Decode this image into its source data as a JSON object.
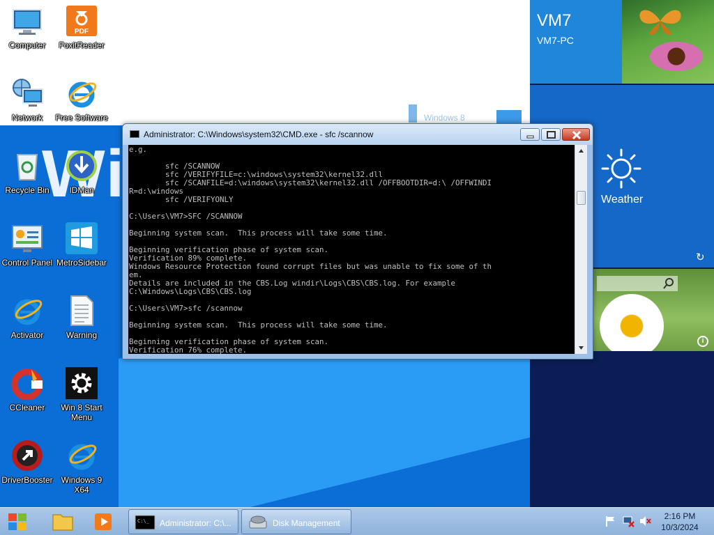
{
  "desktop": {
    "wallpaper_text": "Win",
    "wallpaper_logo_text": "Windows 8",
    "icons": [
      {
        "label": "Computer",
        "icon": "computer-icon"
      },
      {
        "label": "FoxitReader",
        "icon": "pdf-icon",
        "badge": "PDF"
      },
      {
        "label": "Network",
        "icon": "network-icon"
      },
      {
        "label": "Free Software",
        "icon": "internet-explorer-icon"
      },
      {
        "label": "Recycle Bin",
        "icon": "recycle-bin-icon"
      },
      {
        "label": "IDMan",
        "icon": "download-manager-icon"
      },
      {
        "label": "Control Panel",
        "icon": "control-panel-icon"
      },
      {
        "label": "MetroSidebar",
        "icon": "metro-sidebar-icon"
      },
      {
        "label": "Activator",
        "icon": "internet-explorer-icon"
      },
      {
        "label": "Warning",
        "icon": "text-file-icon"
      },
      {
        "label": "CCleaner",
        "icon": "ccleaner-icon"
      },
      {
        "label": "Win 8 Start Menu",
        "icon": "gear-icon"
      },
      {
        "label": "DriverBooster",
        "icon": "driver-booster-icon"
      },
      {
        "label": "Windows 9 X64",
        "icon": "internet-explorer-icon"
      }
    ]
  },
  "metro": {
    "user_name": "VM7",
    "pc_name": "VM7-PC",
    "weather_label": "Weather",
    "refresh_icon": "refresh-icon",
    "info_icon": "info-icon"
  },
  "cmd_window": {
    "title": "Administrator: C:\\Windows\\system32\\CMD.exe - sfc  /scannow",
    "scroll_position": 0.2,
    "lines": [
      "e.g.",
      "",
      "        sfc /SCANNOW",
      "        sfc /VERIFYFILE=c:\\windows\\system32\\kernel32.dll",
      "        sfc /SCANFILE=d:\\windows\\system32\\kernel32.dll /OFFBOOTDIR=d:\\ /OFFWINDI",
      "R=d:\\windows",
      "        sfc /VERIFYONLY",
      "",
      "C:\\Users\\VM7>SFC /SCANNOW",
      "",
      "Beginning system scan.  This process will take some time.",
      "",
      "Beginning verification phase of system scan.",
      "Verification 89% complete.",
      "Windows Resource Protection found corrupt files but was unable to fix some of th",
      "em.",
      "Details are included in the CBS.Log windir\\Logs\\CBS\\CBS.log. For example",
      "C:\\Windows\\Logs\\CBS\\CBS.log",
      "",
      "C:\\Users\\VM7>sfc /scannow",
      "",
      "Beginning system scan.  This process will take some time.",
      "",
      "Beginning verification phase of system scan.",
      "Verification 76% complete."
    ]
  },
  "taskbar": {
    "tasks": [
      {
        "label": "Administrator: C:\\...",
        "icon": "cmd-icon"
      },
      {
        "label": "Disk Management",
        "icon": "disk-management-icon"
      }
    ],
    "clock_time": "2:16 PM",
    "clock_date": "10/3/2024"
  },
  "colors": {
    "wallpaper_blue": "#0a6ed6",
    "metro_bg": "#0a1e55",
    "user_tile": "#1f86d9",
    "weather_tile": "#1468c8",
    "taskbar": "#9cbce2"
  }
}
